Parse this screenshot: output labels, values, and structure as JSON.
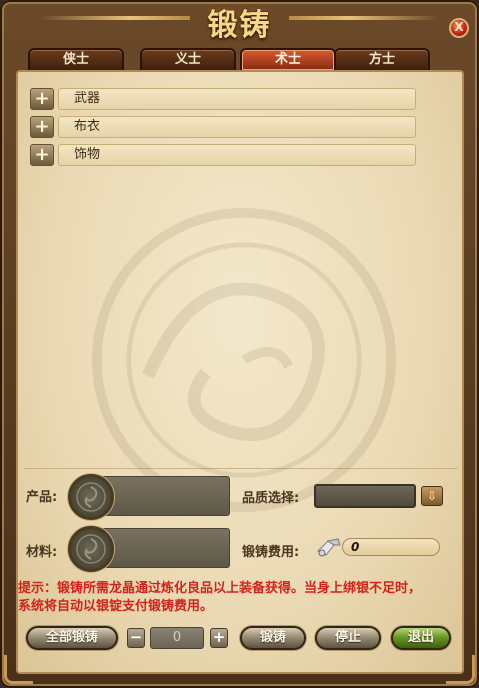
{
  "window": {
    "title": "锻铸",
    "close_glyph": "X"
  },
  "tabs": [
    {
      "label": "侠士",
      "active": false
    },
    {
      "label": "义士",
      "active": false
    },
    {
      "label": "术士",
      "active": true
    },
    {
      "label": "方士",
      "active": false
    }
  ],
  "categories": [
    {
      "expander": "+",
      "label": "武器"
    },
    {
      "expander": "+",
      "label": "布衣"
    },
    {
      "expander": "+",
      "label": "饰物"
    }
  ],
  "form": {
    "product_label": "产品:",
    "material_label": "材料:",
    "quality_label": "品质选择:",
    "quality_value": "",
    "quality_arrow_glyph": "⇩",
    "cost_label": "锻铸费用:",
    "cost_value": "0"
  },
  "hint": "提示：锻铸所需龙晶通过炼化良品以上装备获得。当身上绑银不足时，系统将自动以银锭支付锻铸费用。",
  "footer": {
    "forge_all_label": "全部锻铸",
    "decrease_glyph": "−",
    "quantity_value": "0",
    "increase_glyph": "+",
    "forge_label": "锻铸",
    "stop_label": "停止",
    "exit_label": "退出"
  },
  "colors": {
    "hint": "#d4231a",
    "active_tab": "#d65a30",
    "exit_button": "#6a9a26",
    "title": "#f7d88a"
  }
}
